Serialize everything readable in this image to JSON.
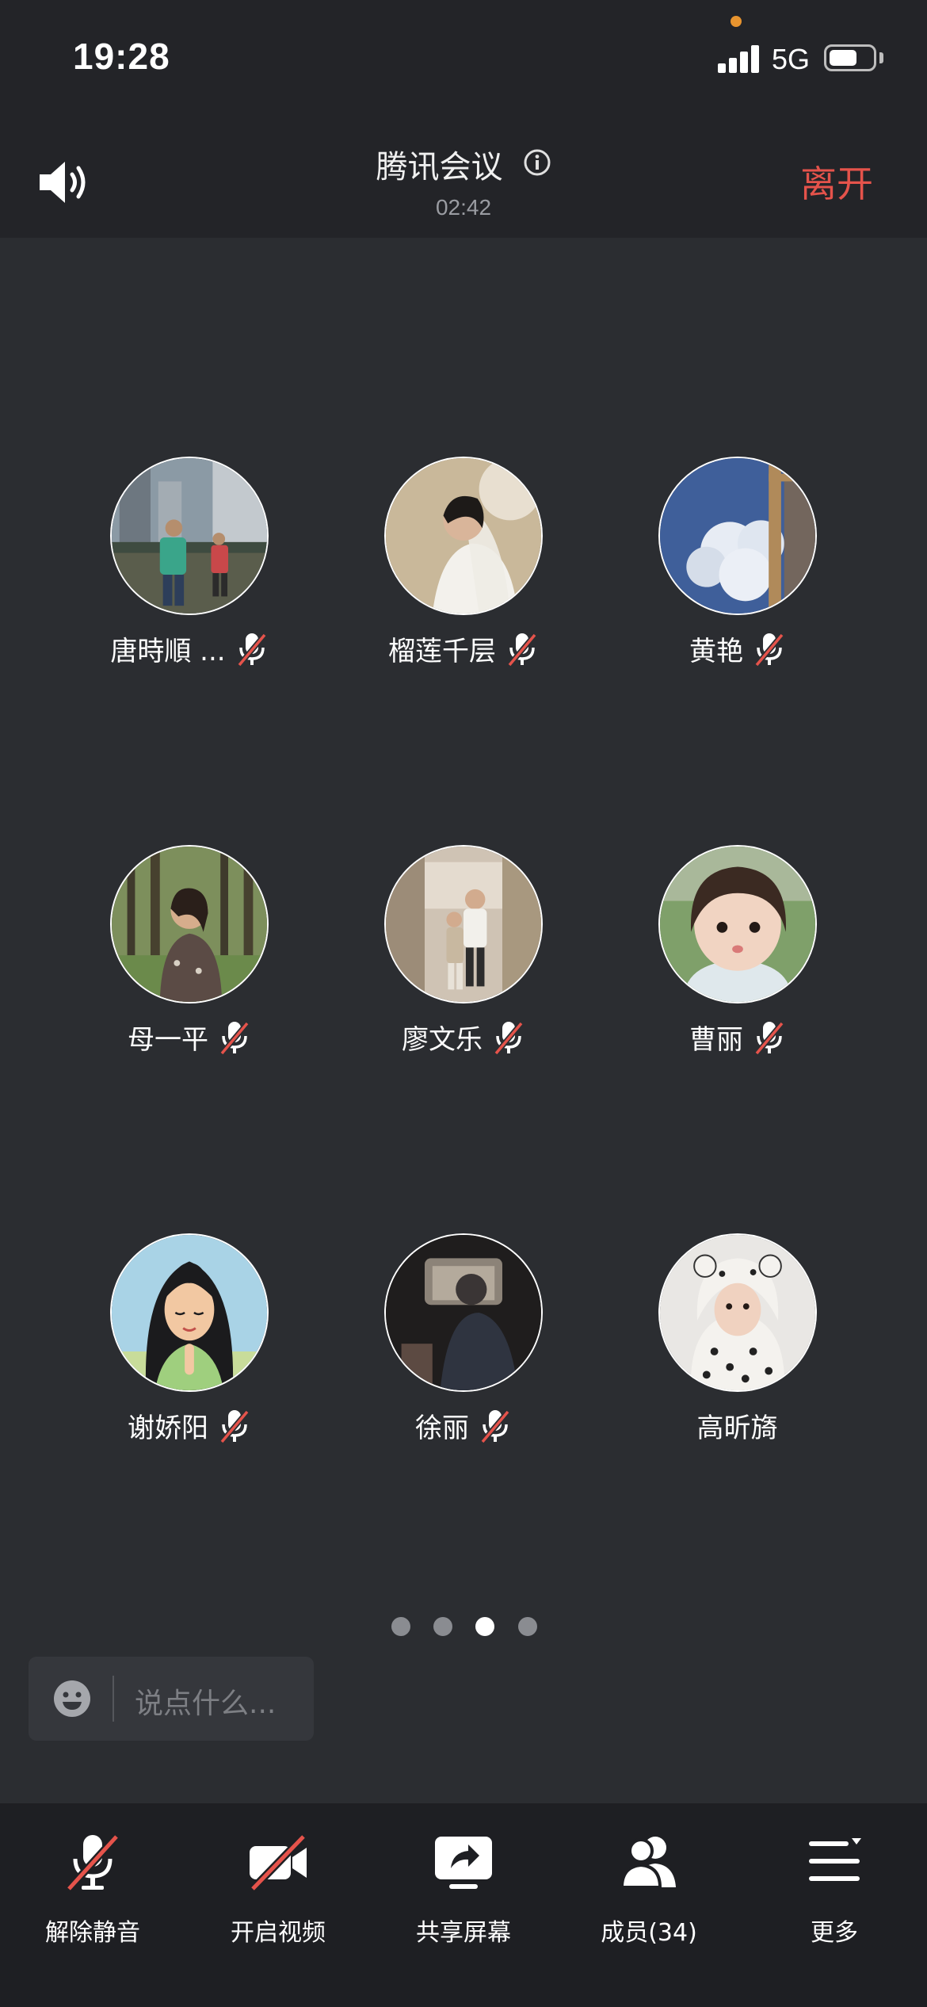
{
  "status_bar": {
    "time": "19:28",
    "network": "5G",
    "icons": [
      "signal-icon",
      "battery-icon"
    ]
  },
  "header": {
    "title": "腾讯会议",
    "duration": "02:42",
    "leave_label": "离开",
    "speaker_icon": "speaker-icon",
    "info_icon": "info-icon"
  },
  "participants": [
    {
      "name": "唐時順 ...",
      "muted": true
    },
    {
      "name": "榴莲千层",
      "muted": true
    },
    {
      "name": "黄艳",
      "muted": true
    },
    {
      "name": "母一平",
      "muted": true
    },
    {
      "name": "廖文乐",
      "muted": true
    },
    {
      "name": "曹丽",
      "muted": true
    },
    {
      "name": "谢娇阳",
      "muted": true
    },
    {
      "name": "徐丽",
      "muted": true
    },
    {
      "name": "高昕旖",
      "muted": false
    }
  ],
  "pagination": {
    "total": 4,
    "active": 3
  },
  "chat": {
    "placeholder": "说点什么..."
  },
  "toolbar": {
    "unmute_label": "解除静音",
    "video_label": "开启视频",
    "share_label": "共享屏幕",
    "members_label": "成员(34)",
    "more_label": "更多"
  },
  "colors": {
    "background": "#2b2d31",
    "header_bg": "#232428",
    "toolbar_bg": "#1e1f23",
    "leave_red": "#e5534b",
    "mute_slash": "#e5534b"
  }
}
